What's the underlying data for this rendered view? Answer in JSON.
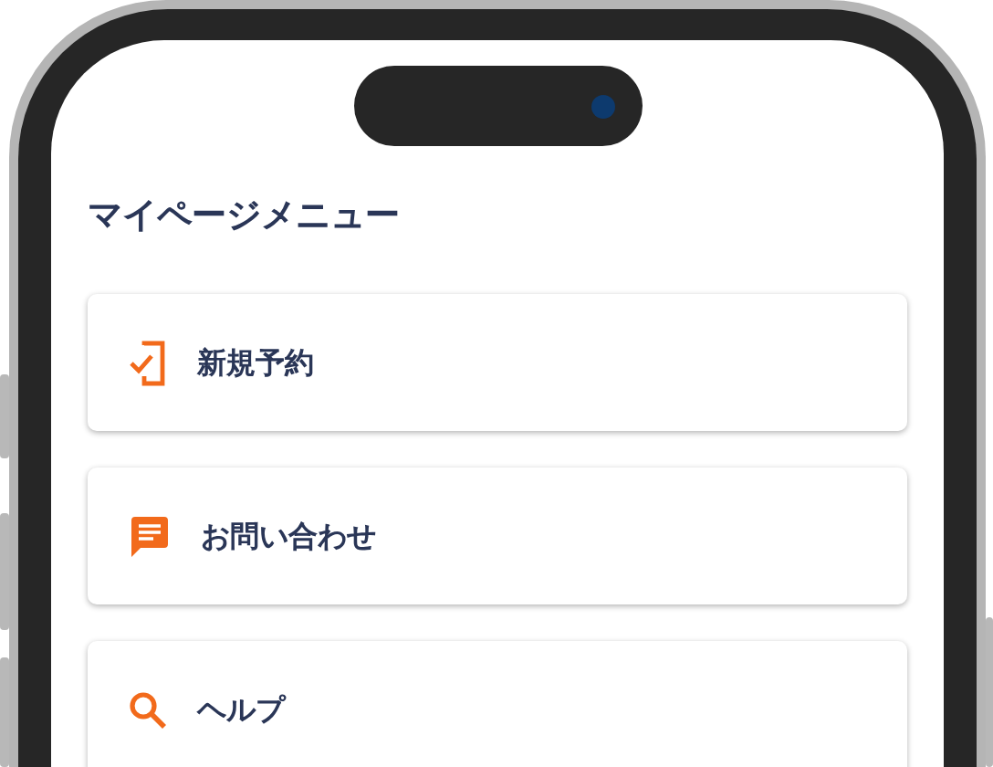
{
  "screen": {
    "title": "マイページメニュー",
    "menu_items": [
      {
        "label": "新規予約",
        "kind": "booking"
      },
      {
        "label": "お問い合わせ",
        "kind": "message"
      },
      {
        "label": "ヘルプ",
        "kind": "search"
      }
    ]
  }
}
